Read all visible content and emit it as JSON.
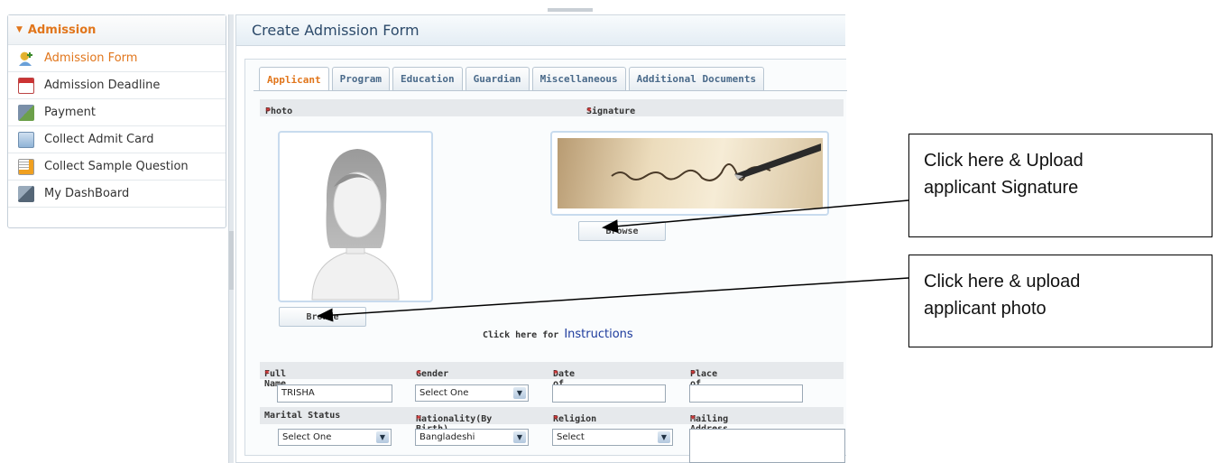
{
  "sidebar": {
    "section_title": "Admission",
    "items": [
      {
        "label": "Admission Form",
        "icon": "person-add-icon",
        "active": true
      },
      {
        "label": "Admission Deadline",
        "icon": "calendar-icon"
      },
      {
        "label": "Payment",
        "icon": "payment-icon"
      },
      {
        "label": "Collect Admit Card",
        "icon": "id-card-icon"
      },
      {
        "label": "Collect Sample Question",
        "icon": "document-icon"
      },
      {
        "label": "My DashBoard",
        "icon": "dashboard-icon"
      }
    ]
  },
  "main": {
    "title": "Create Admission Form",
    "tabs": [
      "Applicant",
      "Program",
      "Education",
      "Guardian",
      "Miscellaneous",
      "Additional Documents"
    ],
    "photo_label": "Photo",
    "signature_label": "Signature",
    "browse_photo": "Browse",
    "browse_signature": "Browse",
    "instructions_prefix": "Click here for",
    "instructions_link": "Instructions",
    "fields": {
      "full_name_label": "Full Name",
      "full_name_value": "TRISHA",
      "gender_label": "Gender",
      "gender_value": "Select One",
      "dob_label": "Date of Birth",
      "dob_value": "",
      "pob_label": "Place of Birth",
      "pob_value": "",
      "marital_label": "Marital Status",
      "marital_value": "Select One",
      "nationality_label": "Nationality(By Birth)",
      "nationality_value": "Bangladeshi",
      "religion_label": "Religion",
      "religion_value": "Select",
      "mailing_label": "Mailing Address",
      "mailing_value": ""
    },
    "required_mark": "*"
  },
  "callouts": {
    "signature": [
      "Click here & Upload",
      "applicant Signature"
    ],
    "photo": [
      "Click here & upload",
      "applicant photo"
    ]
  },
  "colors": {
    "accent": "#e1761c",
    "link": "#1c3a9c",
    "required": "#e03030"
  }
}
